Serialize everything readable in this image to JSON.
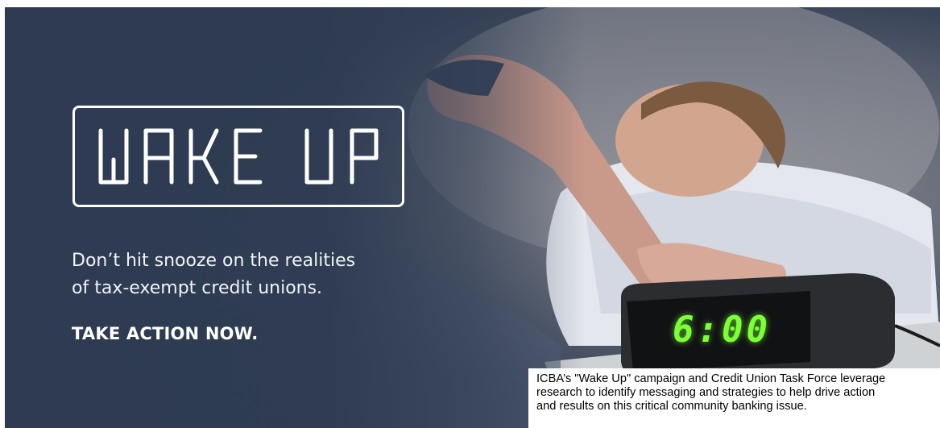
{
  "banner": {
    "logo_text": "WAKE UP",
    "tagline_lines": [
      "Don’t hit snooze on the realities",
      "of tax-exempt credit unions."
    ],
    "cta": "TAKE ACTION NOW.",
    "clock_display": "6:00"
  },
  "caption": {
    "lines": [
      "ICBA’s \"Wake Up\" campaign and Credit Union Task Force leverage",
      "research to identify messaging and strategies to help drive action",
      "and results on this critical community banking issue."
    ]
  },
  "colors": {
    "banner_navy": "#2e3b52",
    "clock_digit_green": "#7dff38",
    "caption_background": "#ffffff"
  }
}
